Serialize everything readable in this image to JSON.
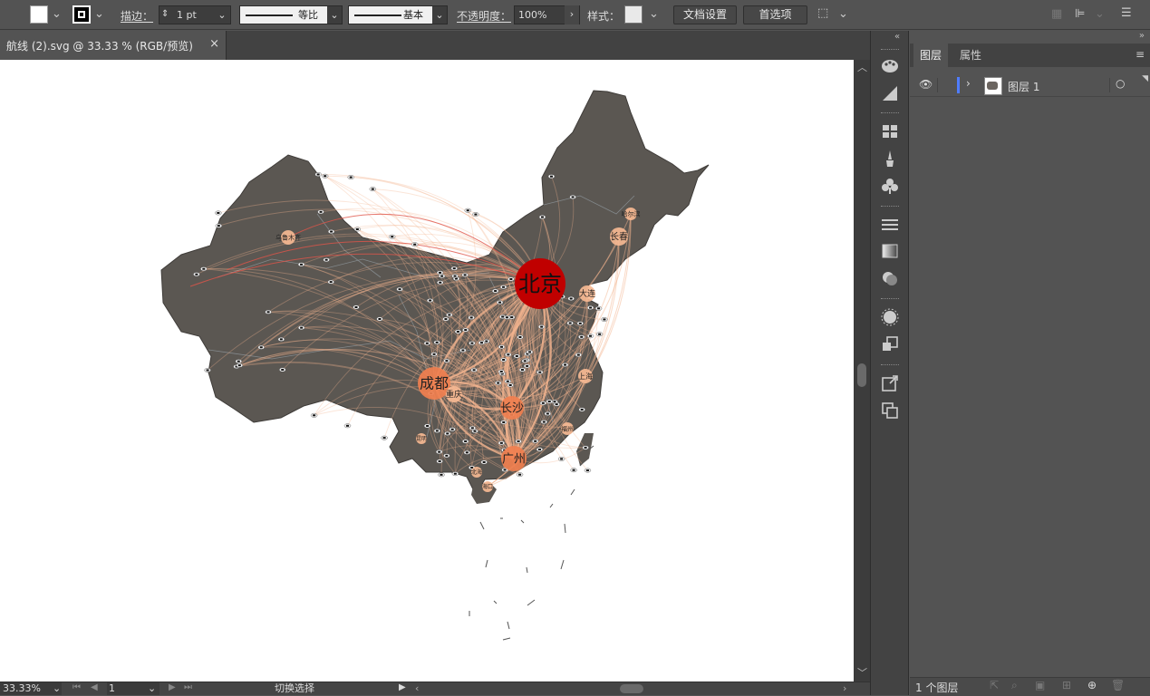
{
  "toolbar": {
    "stroke_label": "描边：",
    "stroke_weight": "1 pt",
    "profile_label": "等比",
    "brush_label": "基本",
    "opacity_label": "不透明度：",
    "opacity_value": "100%",
    "style_label": "样式：",
    "doc_setup_btn": "文档设置",
    "prefs_btn": "首选项"
  },
  "document": {
    "tab_title": "航线 (2).svg @ 33.33 % (RGB/预览)",
    "close_glyph": "×"
  },
  "status": {
    "zoom": "33.33%",
    "page": "1",
    "mode": "切换选择"
  },
  "panel": {
    "tabs": [
      "图层",
      "属性"
    ],
    "layer_name": "图层 1",
    "footer_count": "1 个图层"
  },
  "map": {
    "cities": [
      {
        "name": "北京",
        "size": "xl"
      },
      {
        "name": "成都",
        "size": "l"
      },
      {
        "name": "长沙",
        "size": "m"
      },
      {
        "name": "广州",
        "size": "m"
      },
      {
        "name": "重庆",
        "size": "s"
      },
      {
        "name": "大连",
        "size": "s"
      },
      {
        "name": "长春",
        "size": "s"
      },
      {
        "name": "上海",
        "size": "s"
      },
      {
        "name": "哈尔滨",
        "size": "xs"
      },
      {
        "name": "乌鲁木齐",
        "size": "xs"
      },
      {
        "name": "海口",
        "size": "xs"
      },
      {
        "name": "福州",
        "size": "xs"
      },
      {
        "name": "昆明",
        "size": "xs"
      },
      {
        "name": "北海",
        "size": "xs"
      }
    ],
    "colors": {
      "land": "#5b5752",
      "hub": "#c00000",
      "major": "#f07f4f",
      "minor": "#f6b893",
      "route": "#f4b48e"
    }
  }
}
